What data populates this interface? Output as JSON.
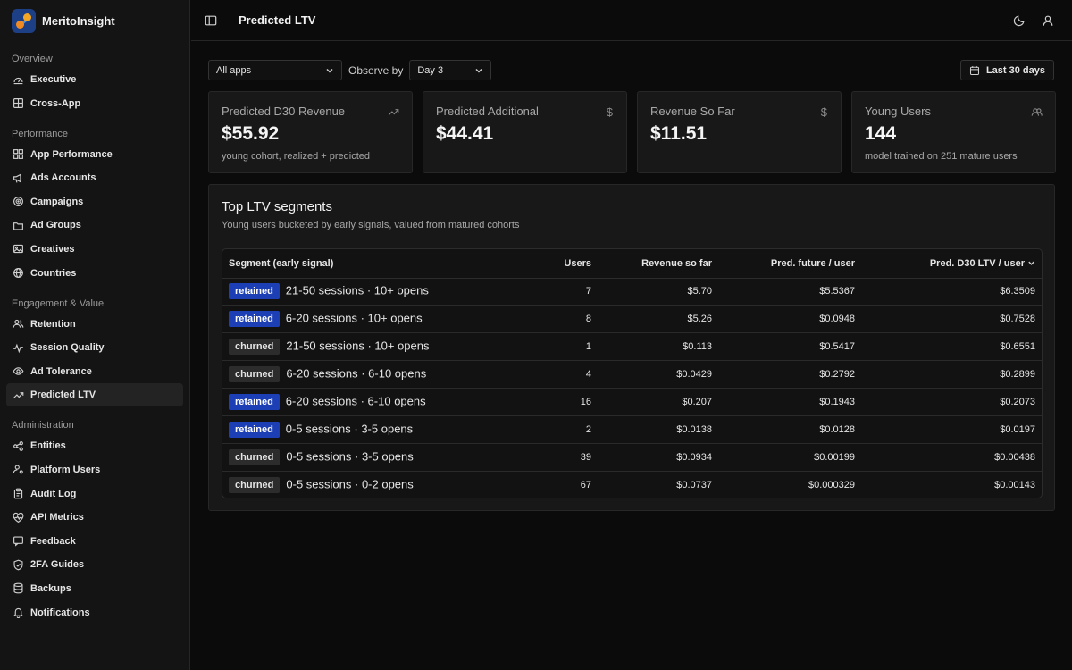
{
  "brand": {
    "name": "MeritoInsight"
  },
  "sidebar": {
    "sections": [
      {
        "heading": "Overview",
        "items": [
          {
            "label": "Executive",
            "icon": "gauge-icon"
          },
          {
            "label": "Cross-App",
            "icon": "grid-icon"
          }
        ]
      },
      {
        "heading": "Performance",
        "items": [
          {
            "label": "App Performance",
            "icon": "apps-icon"
          },
          {
            "label": "Ads Accounts",
            "icon": "megaphone-icon"
          },
          {
            "label": "Campaigns",
            "icon": "target-icon"
          },
          {
            "label": "Ad Groups",
            "icon": "folder-icon"
          },
          {
            "label": "Creatives",
            "icon": "image-icon"
          },
          {
            "label": "Countries",
            "icon": "globe-icon"
          }
        ]
      },
      {
        "heading": "Engagement & Value",
        "items": [
          {
            "label": "Retention",
            "icon": "users-icon"
          },
          {
            "label": "Session Quality",
            "icon": "activity-icon"
          },
          {
            "label": "Ad Tolerance",
            "icon": "eye-icon"
          },
          {
            "label": "Predicted LTV",
            "icon": "trend-icon",
            "active": true
          }
        ]
      },
      {
        "heading": "Administration",
        "items": [
          {
            "label": "Entities",
            "icon": "share-icon"
          },
          {
            "label": "Platform Users",
            "icon": "user-cog-icon"
          },
          {
            "label": "Audit Log",
            "icon": "clipboard-icon"
          },
          {
            "label": "API Metrics",
            "icon": "heart-pulse-icon"
          },
          {
            "label": "Feedback",
            "icon": "message-icon"
          },
          {
            "label": "2FA Guides",
            "icon": "shield-icon"
          },
          {
            "label": "Backups",
            "icon": "database-icon"
          },
          {
            "label": "Notifications",
            "icon": "bell-icon"
          }
        ]
      }
    ]
  },
  "header": {
    "title": "Predicted LTV"
  },
  "filters": {
    "app_select": "All apps",
    "observe_label": "Observe by",
    "day_select": "Day 3",
    "date_range": "Last 30 days"
  },
  "kpis": [
    {
      "label": "Predicted D30 Revenue",
      "value": "$55.92",
      "sub": "young cohort, realized + predicted",
      "icon": "trend-up-icon"
    },
    {
      "label": "Predicted Additional",
      "value": "$44.41",
      "sub": "",
      "icon": "dollar-icon"
    },
    {
      "label": "Revenue So Far",
      "value": "$11.51",
      "sub": "",
      "icon": "dollar-icon"
    },
    {
      "label": "Young Users",
      "value": "144",
      "sub": "model trained on 251 mature users",
      "icon": "users-icon"
    }
  ],
  "segments": {
    "title": "Top LTV segments",
    "subtitle": "Young users bucketed by early signals, valued from matured cohorts",
    "columns": [
      "Segment (early signal)",
      "Users",
      "Revenue so far",
      "Pred. future / user",
      "Pred. D30 LTV / user"
    ],
    "rows": [
      {
        "status": "retained",
        "segment": "21-50 sessions · 10+ opens",
        "users": "7",
        "revenue": "$5.70",
        "future": "$5.5367",
        "ltv": "$6.3509"
      },
      {
        "status": "retained",
        "segment": "6-20 sessions · 10+ opens",
        "users": "8",
        "revenue": "$5.26",
        "future": "$0.0948",
        "ltv": "$0.7528"
      },
      {
        "status": "churned",
        "segment": "21-50 sessions · 10+ opens",
        "users": "1",
        "revenue": "$0.113",
        "future": "$0.5417",
        "ltv": "$0.6551"
      },
      {
        "status": "churned",
        "segment": "6-20 sessions · 6-10 opens",
        "users": "4",
        "revenue": "$0.0429",
        "future": "$0.2792",
        "ltv": "$0.2899"
      },
      {
        "status": "retained",
        "segment": "6-20 sessions · 6-10 opens",
        "users": "16",
        "revenue": "$0.207",
        "future": "$0.1943",
        "ltv": "$0.2073"
      },
      {
        "status": "retained",
        "segment": "0-5 sessions · 3-5 opens",
        "users": "2",
        "revenue": "$0.0138",
        "future": "$0.0128",
        "ltv": "$0.0197"
      },
      {
        "status": "churned",
        "segment": "0-5 sessions · 3-5 opens",
        "users": "39",
        "revenue": "$0.0934",
        "future": "$0.00199",
        "ltv": "$0.00438"
      },
      {
        "status": "churned",
        "segment": "0-5 sessions · 0-2 opens",
        "users": "67",
        "revenue": "$0.0737",
        "future": "$0.000329",
        "ltv": "$0.00143"
      }
    ]
  }
}
